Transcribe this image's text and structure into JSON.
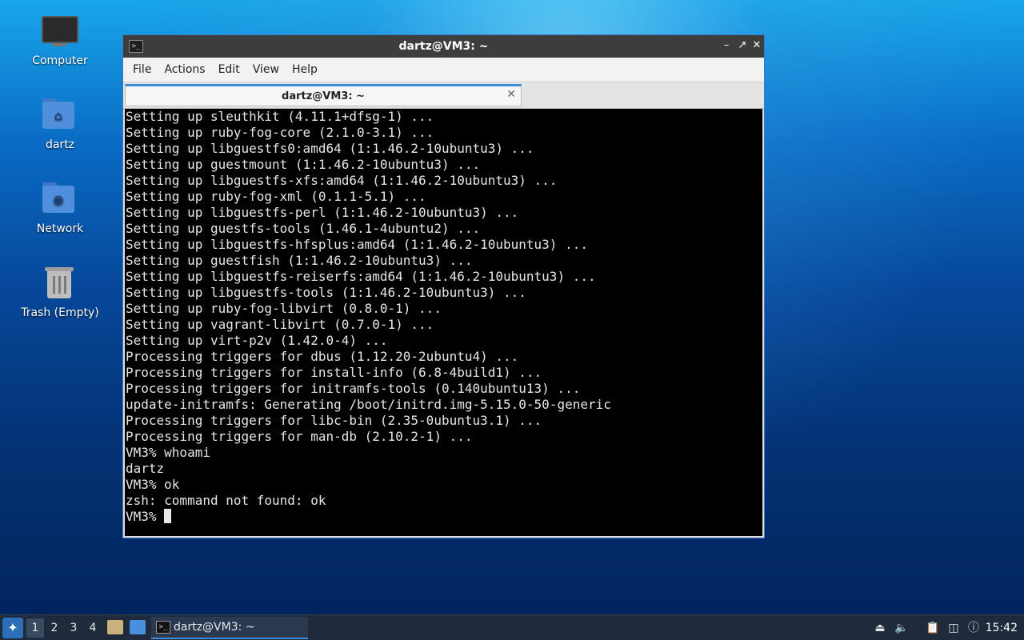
{
  "desktop": {
    "icons": [
      {
        "label": "Computer"
      },
      {
        "label": "dartz"
      },
      {
        "label": "Network"
      },
      {
        "label": "Trash (Empty)"
      }
    ]
  },
  "window": {
    "title": "dartz@VM3: ~",
    "menu": [
      "File",
      "Actions",
      "Edit",
      "View",
      "Help"
    ],
    "tab_title": "dartz@VM3: ~",
    "terminal_lines": [
      "Setting up sleuthkit (4.11.1+dfsg-1) ...",
      "Setting up ruby-fog-core (2.1.0-3.1) ...",
      "Setting up libguestfs0:amd64 (1:1.46.2-10ubuntu3) ...",
      "Setting up guestmount (1:1.46.2-10ubuntu3) ...",
      "Setting up libguestfs-xfs:amd64 (1:1.46.2-10ubuntu3) ...",
      "Setting up ruby-fog-xml (0.1.1-5.1) ...",
      "Setting up libguestfs-perl (1:1.46.2-10ubuntu3) ...",
      "Setting up guestfs-tools (1.46.1-4ubuntu2) ...",
      "Setting up libguestfs-hfsplus:amd64 (1:1.46.2-10ubuntu3) ...",
      "Setting up guestfish (1:1.46.2-10ubuntu3) ...",
      "Setting up libguestfs-reiserfs:amd64 (1:1.46.2-10ubuntu3) ...",
      "Setting up libguestfs-tools (1:1.46.2-10ubuntu3) ...",
      "Setting up ruby-fog-libvirt (0.8.0-1) ...",
      "Setting up vagrant-libvirt (0.7.0-1) ...",
      "Setting up virt-p2v (1.42.0-4) ...",
      "Processing triggers for dbus (1.12.20-2ubuntu4) ...",
      "Processing triggers for install-info (6.8-4build1) ...",
      "Processing triggers for initramfs-tools (0.140ubuntu13) ...",
      "update-initramfs: Generating /boot/initrd.img-5.15.0-50-generic",
      "Processing triggers for libc-bin (2.35-0ubuntu3.1) ...",
      "Processing triggers for man-db (2.10.2-1) ...",
      "VM3% whoami",
      "dartz",
      "VM3% ok",
      "zsh: command not found: ok"
    ],
    "prompt": "VM3% "
  },
  "taskbar": {
    "workspaces": [
      "1",
      "2",
      "3",
      "4"
    ],
    "active_workspace": "1",
    "task_label": "dartz@VM3: ~",
    "clock": "15:42"
  },
  "colors": {
    "accent": "#3b8fd9",
    "titlebar": "#3d3d3d",
    "terminal_bg": "#000000",
    "taskbar_bg": "#1f2b3c"
  }
}
